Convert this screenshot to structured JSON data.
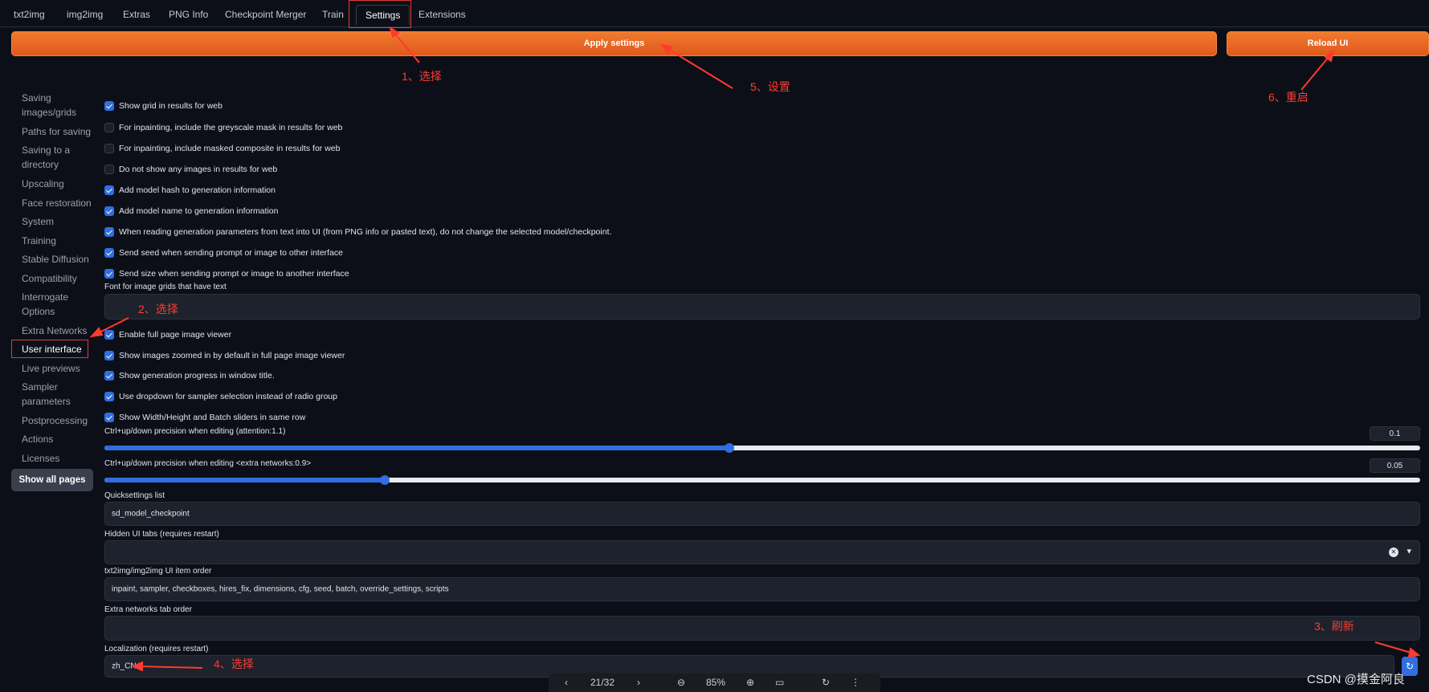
{
  "tabs": [
    "txt2img",
    "img2img",
    "Extras",
    "PNG Info",
    "Checkpoint Merger",
    "Train",
    "Settings",
    "Extensions"
  ],
  "buttons": {
    "apply": "Apply settings",
    "reload": "Reload UI"
  },
  "sidebar": {
    "items": [
      "Saving images/grids",
      "Paths for saving",
      "Saving to a directory",
      "Upscaling",
      "Face restoration",
      "System",
      "Training",
      "Stable Diffusion",
      "Compatibility",
      "Interrogate Options",
      "Extra Networks",
      "User interface",
      "Live previews",
      "Sampler parameters",
      "Postprocessing",
      "Actions",
      "Licenses"
    ],
    "show_all": "Show all pages"
  },
  "checkboxes_top": [
    {
      "label": "Show grid in results for web",
      "checked": true
    },
    {
      "label": "For inpainting, include the greyscale mask in results for web",
      "checked": false
    },
    {
      "label": "For inpainting, include masked composite in results for web",
      "checked": false
    },
    {
      "label": "Do not show any images in results for web",
      "checked": false
    },
    {
      "label": "Add model hash to generation information",
      "checked": true
    },
    {
      "label": "Add model name to generation information",
      "checked": true
    },
    {
      "label": "When reading generation parameters from text into UI (from PNG info or pasted text), do not change the selected model/checkpoint.",
      "checked": true
    },
    {
      "label": "Send seed when sending prompt or image to other interface",
      "checked": true
    },
    {
      "label": "Send size when sending prompt or image to another interface",
      "checked": true
    }
  ],
  "font_field_label": "Font for image grids that have text",
  "checkboxes_ui": [
    {
      "label": "Enable full page image viewer",
      "checked": true
    },
    {
      "label": "Show images zoomed in by default in full page image viewer",
      "checked": true
    },
    {
      "label": "Show generation progress in window title.",
      "checked": true
    },
    {
      "label": "Use dropdown for sampler selection instead of radio group",
      "checked": true
    },
    {
      "label": "Show Width/Height and Batch sliders in same row",
      "checked": true
    }
  ],
  "slider_attention": {
    "label": "Ctrl+up/down precision when editing (attention:1.1)",
    "value": "0.1",
    "fraction": 0.475
  },
  "slider_extra": {
    "label": "Ctrl+up/down precision when editing <extra networks:0.9>",
    "value": "0.05",
    "fraction": 0.213
  },
  "quicksettings": {
    "label": "Quicksettings list",
    "value": "sd_model_checkpoint"
  },
  "hidden_tabs": {
    "label": "Hidden UI tabs (requires restart)",
    "clear_icon": "✕",
    "dropdown_icon": "▾"
  },
  "item_order": {
    "label": "txt2img/img2img UI item order",
    "value": "inpaint, sampler, checkboxes, hires_fix, dimensions, cfg, seed, batch, override_settings, scripts"
  },
  "extra_tab_order": {
    "label": "Extra networks tab order",
    "value": ""
  },
  "localization": {
    "label": "Localization (requires restart)",
    "value": "zh_CN"
  },
  "annotations": [
    "1、选择",
    "2、选择",
    "3、刷新",
    "4、选择",
    "5、设置",
    "6、重启"
  ],
  "viewer_toolbar": {
    "page": "21/32",
    "zoom": "85%"
  },
  "watermark": "CSDN @摸金阿良",
  "colors": {
    "accent": "#2f6fe0",
    "orange": "#ec6a24",
    "annotation": "#ff3b30",
    "background": "#0c0f17"
  }
}
